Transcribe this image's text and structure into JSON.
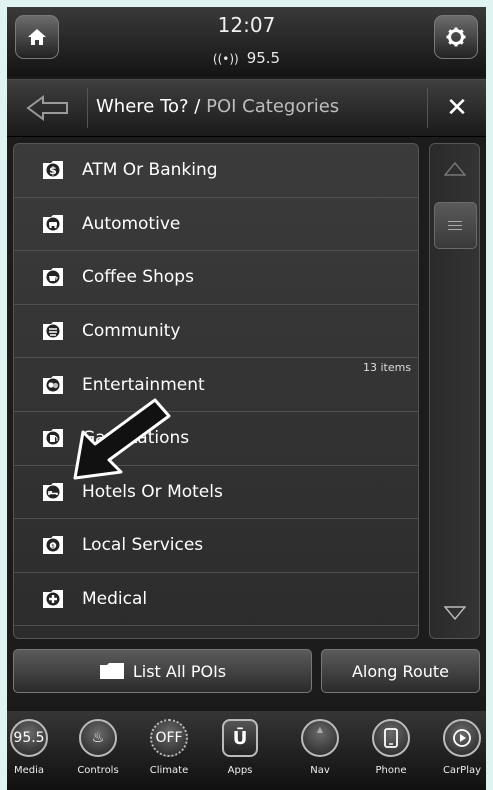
{
  "status": {
    "time": "12:07",
    "station": "95.5"
  },
  "header": {
    "title_main": "Where To? /",
    "title_sub": "POI Categories"
  },
  "list": {
    "item_count": "13 items",
    "items": [
      {
        "label": "ATM Or Banking",
        "icon": "bank-icon"
      },
      {
        "label": "Automotive",
        "icon": "car-icon"
      },
      {
        "label": "Coffee Shops",
        "icon": "coffee-icon"
      },
      {
        "label": "Community",
        "icon": "community-icon"
      },
      {
        "label": "Entertainment",
        "icon": "masks-icon"
      },
      {
        "label": "Gas Stations",
        "icon": "fuel-icon"
      },
      {
        "label": "Hotels Or Motels",
        "icon": "bed-icon"
      },
      {
        "label": "Local Services",
        "icon": "services-icon"
      },
      {
        "label": "Medical",
        "icon": "medical-cross-icon"
      }
    ]
  },
  "actions": {
    "list_all": "List All POIs",
    "along_route": "Along Route"
  },
  "dock": {
    "media_value": "95.5",
    "climate_value": "OFF",
    "labels": [
      "Media",
      "Controls",
      "Climate",
      "Apps",
      "Nav",
      "Phone",
      "CarPlay"
    ]
  }
}
